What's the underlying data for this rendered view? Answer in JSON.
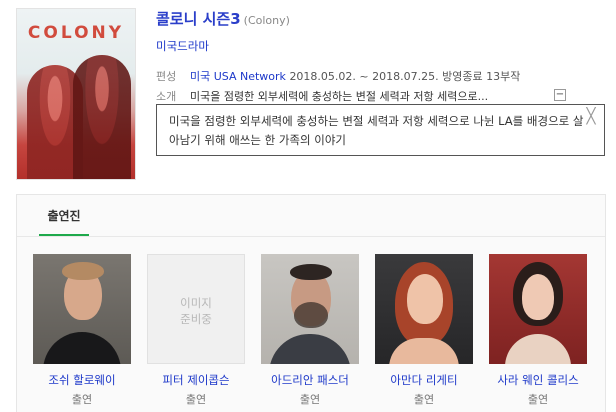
{
  "show": {
    "title": "콜로니 시즌3",
    "subtitle": "(Colony)",
    "genre": "미국드라마",
    "poster_text": "COLONY"
  },
  "info": {
    "broadcast_label": "편성",
    "broadcast_network": "미국 USA Network",
    "broadcast_detail": "2018.05.02. ~ 2018.07.25. 방영종료 13부작",
    "intro_label": "소개",
    "intro_text": "미국을 점령한 외부세력에 충성하는 변절 세력과 저항 세력으로...",
    "toggle_symbol": "−"
  },
  "tooltip": {
    "text": "미국을 점령한 외부세력에 충성하는 변절 세력과 저항 세력으로 나뉜 LA를 배경으로 살아남기 위해 애쓰는 한 가족의 이야기",
    "close_symbol": "╳"
  },
  "cast": {
    "tab_label": "출연진",
    "members": [
      {
        "name": "조쉬 할로웨이",
        "role": "출연"
      },
      {
        "name": "피터 제이콥슨",
        "role": "출연",
        "placeholder": "이미지 준비중"
      },
      {
        "name": "아드리안 패스더",
        "role": "출연"
      },
      {
        "name": "아만다 리게티",
        "role": "출연"
      },
      {
        "name": "사라 웨인 콜리스",
        "role": "출연"
      }
    ]
  },
  "colors": {
    "link": "#1d38c9",
    "tab_underline": "#1ea94b",
    "poster_red": "#c6453f"
  }
}
